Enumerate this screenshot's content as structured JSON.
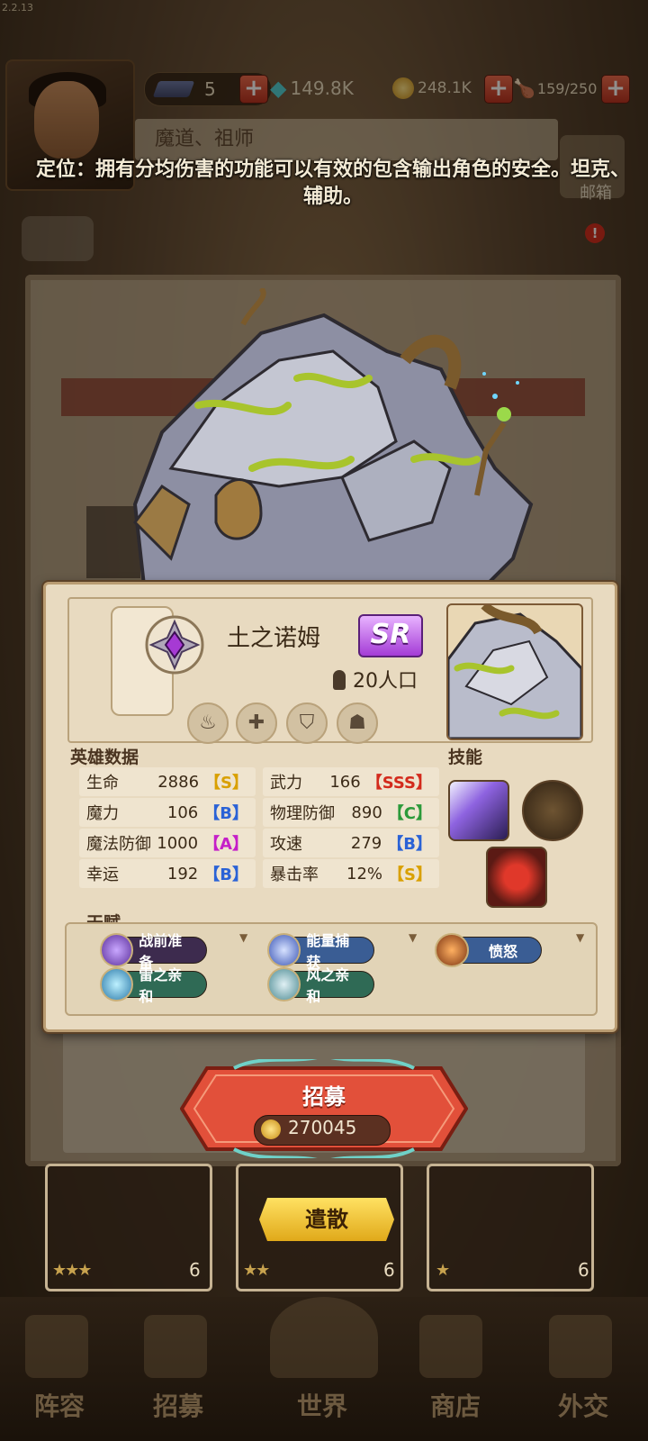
{
  "version": "2.2.13",
  "resources": {
    "energy": "5",
    "gems": "149.8K",
    "gold": "248.1K",
    "food": "159/250"
  },
  "top_title": "魔道、祖师",
  "role_description": "定位：拥有分均伤害的功能可以有效的包含输出角色的安全。坦克、辅助。",
  "mail_label": "邮箱",
  "hero": {
    "name": "土之诺姆",
    "rarity": "SR",
    "population": "20人口",
    "traits": [
      "water-drop-icon",
      "cross-icon",
      "shield-icon",
      "body-icon"
    ]
  },
  "stats_title": "英雄数据",
  "skills_title": "技能",
  "stats": [
    {
      "label": "生命",
      "value": "2886",
      "grade": "【S】",
      "color": "#d9a000"
    },
    {
      "label": "武力",
      "value": "166",
      "grade": "【SSS】",
      "color": "#d32a1c"
    },
    {
      "label": "魔力",
      "value": "106",
      "grade": "【B】",
      "color": "#2a62d6"
    },
    {
      "label": "物理防御",
      "value": "890",
      "grade": "【C】",
      "color": "#2b9a3a"
    },
    {
      "label": "魔法防御",
      "value": "1000",
      "grade": "【A】",
      "color": "#c51fc8"
    },
    {
      "label": "攻速",
      "value": "279",
      "grade": "【B】",
      "color": "#2a62d6"
    },
    {
      "label": "幸运",
      "value": "192",
      "grade": "【B】",
      "color": "#2a62d6"
    },
    {
      "label": "暴击率",
      "value": "12%",
      "grade": "【S】",
      "color": "#d9a000"
    }
  ],
  "talents_title": "天赋",
  "talents": [
    {
      "label": "战前准备",
      "color": "#3d2b4e"
    },
    {
      "label": "能量捕获",
      "color": "#3a5d94"
    },
    {
      "label": "愤怒",
      "color": "#3a5d94"
    },
    {
      "label": "雷之亲和",
      "color": "#2f6a55"
    },
    {
      "label": "风之亲和",
      "color": "#2f6a55"
    }
  ],
  "recruit": {
    "label": "招募",
    "cost": "270045"
  },
  "dismiss_label": "遣散",
  "slots": [
    {
      "stars": "★★★",
      "count": "6"
    },
    {
      "stars": "★★",
      "count": "6"
    },
    {
      "stars": "★",
      "count": "6"
    }
  ],
  "nav": [
    "阵容",
    "招募",
    "世界",
    "商店",
    "外交"
  ]
}
